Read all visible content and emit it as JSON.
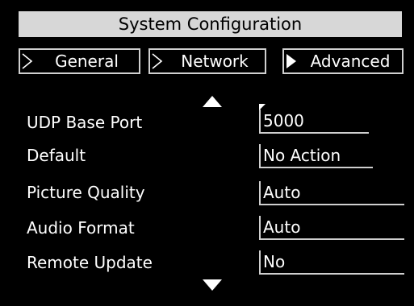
{
  "title": "System Configuration",
  "tabs": [
    {
      "label": "General",
      "active": false
    },
    {
      "label": "Network",
      "active": false
    },
    {
      "label": "Advanced",
      "active": true
    }
  ],
  "settings": [
    {
      "label": "UDP Base Port",
      "value": "5000"
    },
    {
      "label": "Default",
      "value": "No Action"
    },
    {
      "label": "Picture Quality",
      "value": "Auto"
    },
    {
      "label": "Audio Format",
      "value": "Auto"
    },
    {
      "label": "Remote Update",
      "value": "No"
    }
  ],
  "icons": {
    "tab_marker": "triangle-right-icon",
    "scroll_up": "triangle-up-icon",
    "scroll_down": "triangle-down-icon",
    "focus_marker": "corner-marker-icon"
  },
  "colors": {
    "background": "#000000",
    "title_bar": "#d7d7d7",
    "text": "#ffffff",
    "border": "#d0d0d0"
  }
}
